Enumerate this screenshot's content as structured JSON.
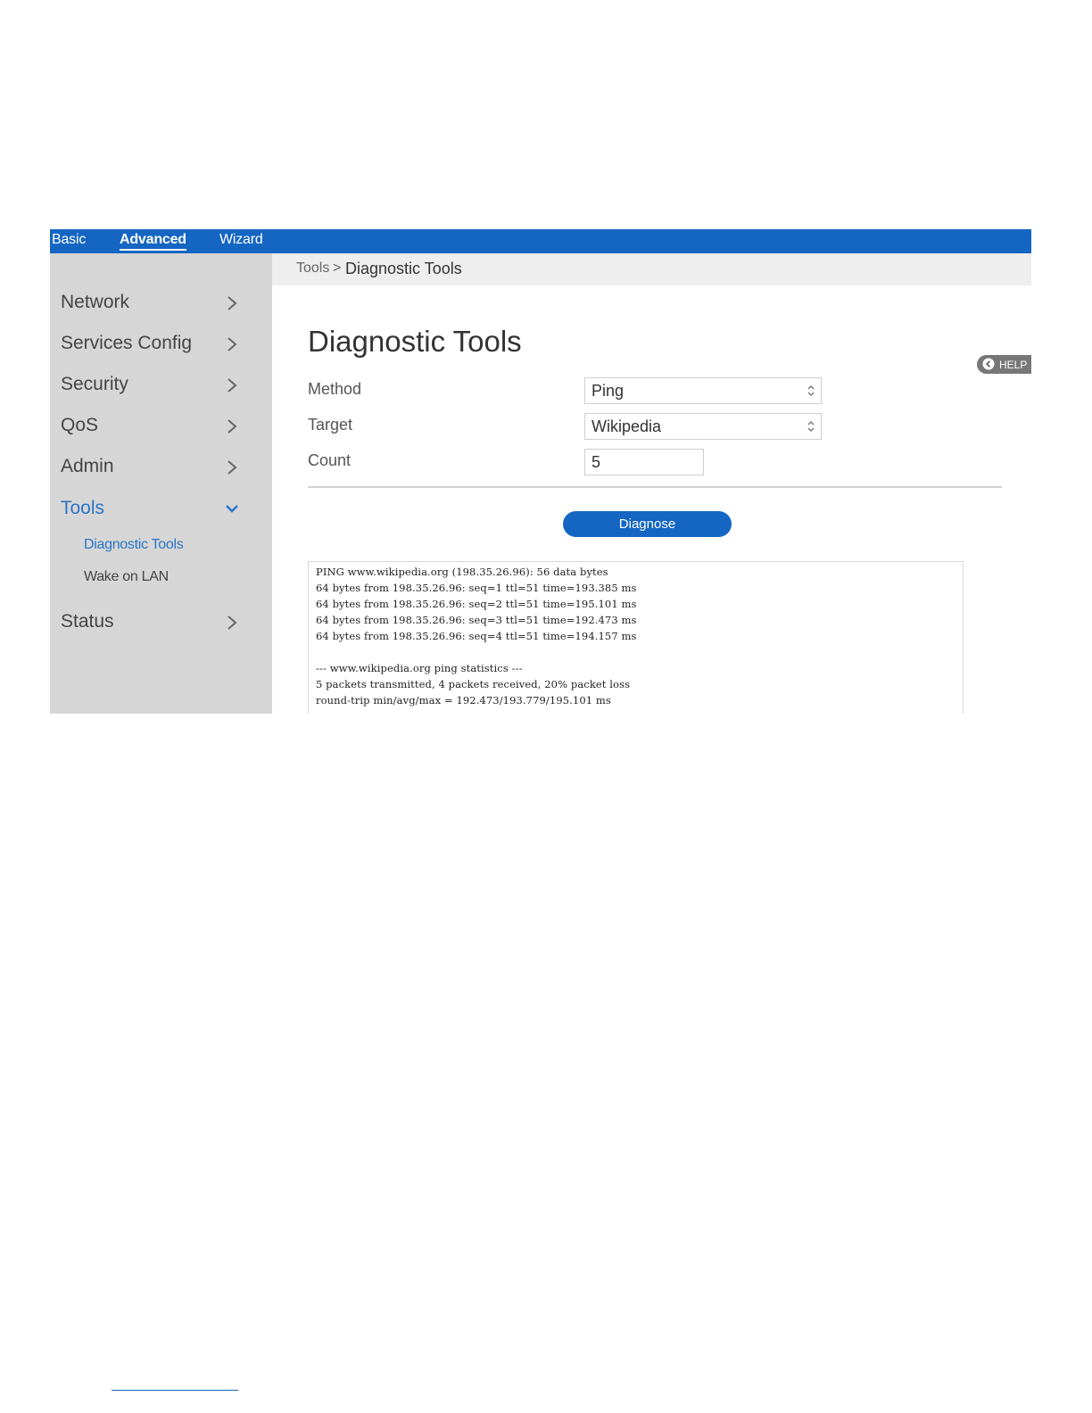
{
  "topbar": {
    "tabs": [
      {
        "label": "Basic"
      },
      {
        "label": "Advanced"
      },
      {
        "label": "Wizard"
      }
    ]
  },
  "sidebar": {
    "items": [
      {
        "label": "Network"
      },
      {
        "label": "Services Config"
      },
      {
        "label": "Security"
      },
      {
        "label": "QoS"
      },
      {
        "label": "Admin"
      },
      {
        "label": "Tools"
      },
      {
        "label": "Status"
      }
    ],
    "tools_subitems": [
      {
        "label": "Diagnostic Tools"
      },
      {
        "label": "Wake on LAN"
      }
    ]
  },
  "breadcrumb": {
    "parent": "Tools",
    "separator": ">",
    "current": "Diagnostic Tools"
  },
  "page": {
    "title": "Diagnostic Tools",
    "help_label": "HELP"
  },
  "form": {
    "method_label": "Method",
    "method_value": "Ping",
    "target_label": "Target",
    "target_value": "Wikipedia",
    "count_label": "Count",
    "count_value": "5",
    "diagnose_label": "Diagnose"
  },
  "output": {
    "lines": [
      "PING www.wikipedia.org (198.35.26.96): 56 data bytes",
      "64 bytes from 198.35.26.96: seq=1 ttl=51 time=193.385 ms",
      "64 bytes from 198.35.26.96: seq=2 ttl=51 time=195.101 ms",
      "64 bytes from 198.35.26.96: seq=3 ttl=51 time=192.473 ms",
      "64 bytes from 198.35.26.96: seq=4 ttl=51 time=194.157 ms",
      "",
      "--- www.wikipedia.org ping statistics ---",
      "5 packets transmitted, 4 packets received, 20% packet loss",
      "round-trip min/avg/max = 192.473/193.779/195.101 ms"
    ]
  },
  "colors": {
    "accent": "#1466c2",
    "active_link": "#2a74c6",
    "sidebar_bg": "#d6d6d6"
  },
  "icons": {
    "collapsed": "chevron-right-icon",
    "expanded": "chevron-down-icon",
    "select": "up-down-arrows-icon",
    "help": "chevron-left-circle-icon"
  }
}
